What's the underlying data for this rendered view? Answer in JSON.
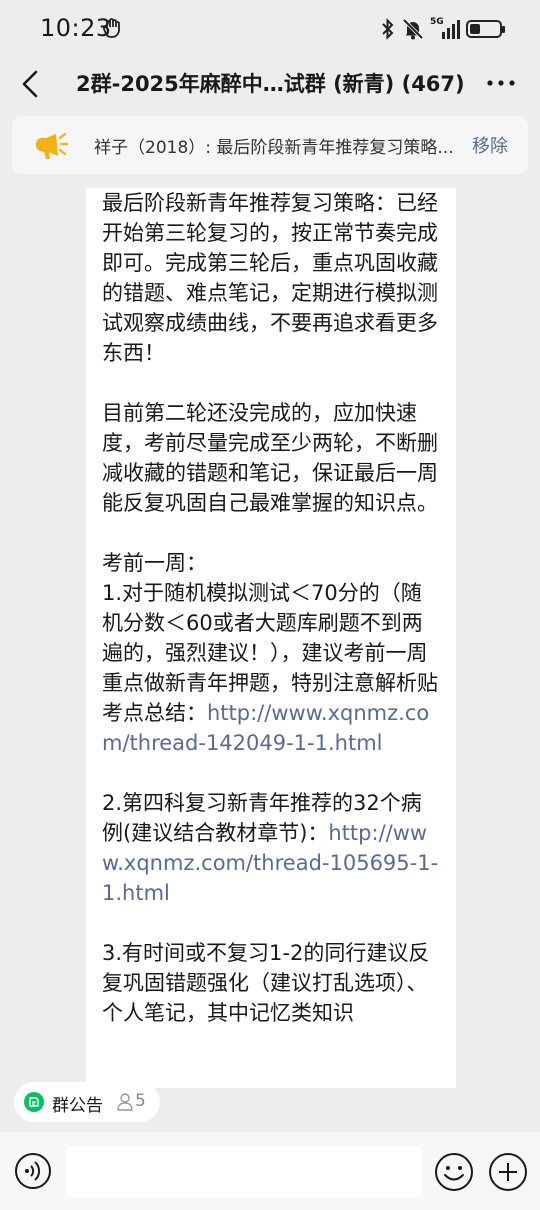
{
  "status_bar": {
    "time": "10:23",
    "network": "5G",
    "battery_level": 0.35
  },
  "header": {
    "title": "2群-2025年麻醉中…试群 (新青) (467)"
  },
  "pinned": {
    "text": "祥子（2018）: 最后阶段新青年推荐复习策略...",
    "remove_label": "移除"
  },
  "message": {
    "paragraphs": [
      {
        "text": "最后阶段新青年推荐复习策略：已经开始第三轮复习的，按正常节奏完成即可。完成第三轮后，重点巩固收藏的错题、难点笔记，定期进行模拟测试观察成绩曲线，不要再追求看更多东西！"
      },
      {
        "text": "目前第二轮还没完成的，应加快速度，考前尽量完成至少两轮，不断删减收藏的错题和笔记，保证最后一周能反复巩固自己最难掌握的知识点。"
      },
      {
        "text": "考前一周：\n1.对于随机模拟测试＜70分的（随机分数＜60或者大题库刷题不到两遍的，强烈建议！），建议考前一周重点做新青年押题，特别注意解析贴考点总结：",
        "link": "http://www.xqnmz.com/thread-142049-1-1.html"
      },
      {
        "text": "2.第四科复习新青年推荐的32个病例(建议结合教材章节)：",
        "link": "http://www.xqnmz.com/thread-105695-1-1.html"
      },
      {
        "text": "3.有时间或不复习1-2的同行建议反复巩固错题强化（建议打乱选项）、个人笔记，其中记忆类知识"
      }
    ]
  },
  "bottom": {
    "notice_label": "群公告",
    "member_count": "5",
    "input_value": ""
  },
  "icons": {
    "back": "back-arrow-icon",
    "more": "more-dots-icon",
    "pin": "horn-icon",
    "voice": "voice-icon",
    "emoji": "emoji-icon",
    "plus": "plus-icon",
    "notice": "notice-icon",
    "member": "member-icon"
  },
  "colors": {
    "link": "#576b95",
    "accent_green": "#07c160",
    "horn_yellow": "#f5b014",
    "background": "#ededed"
  }
}
